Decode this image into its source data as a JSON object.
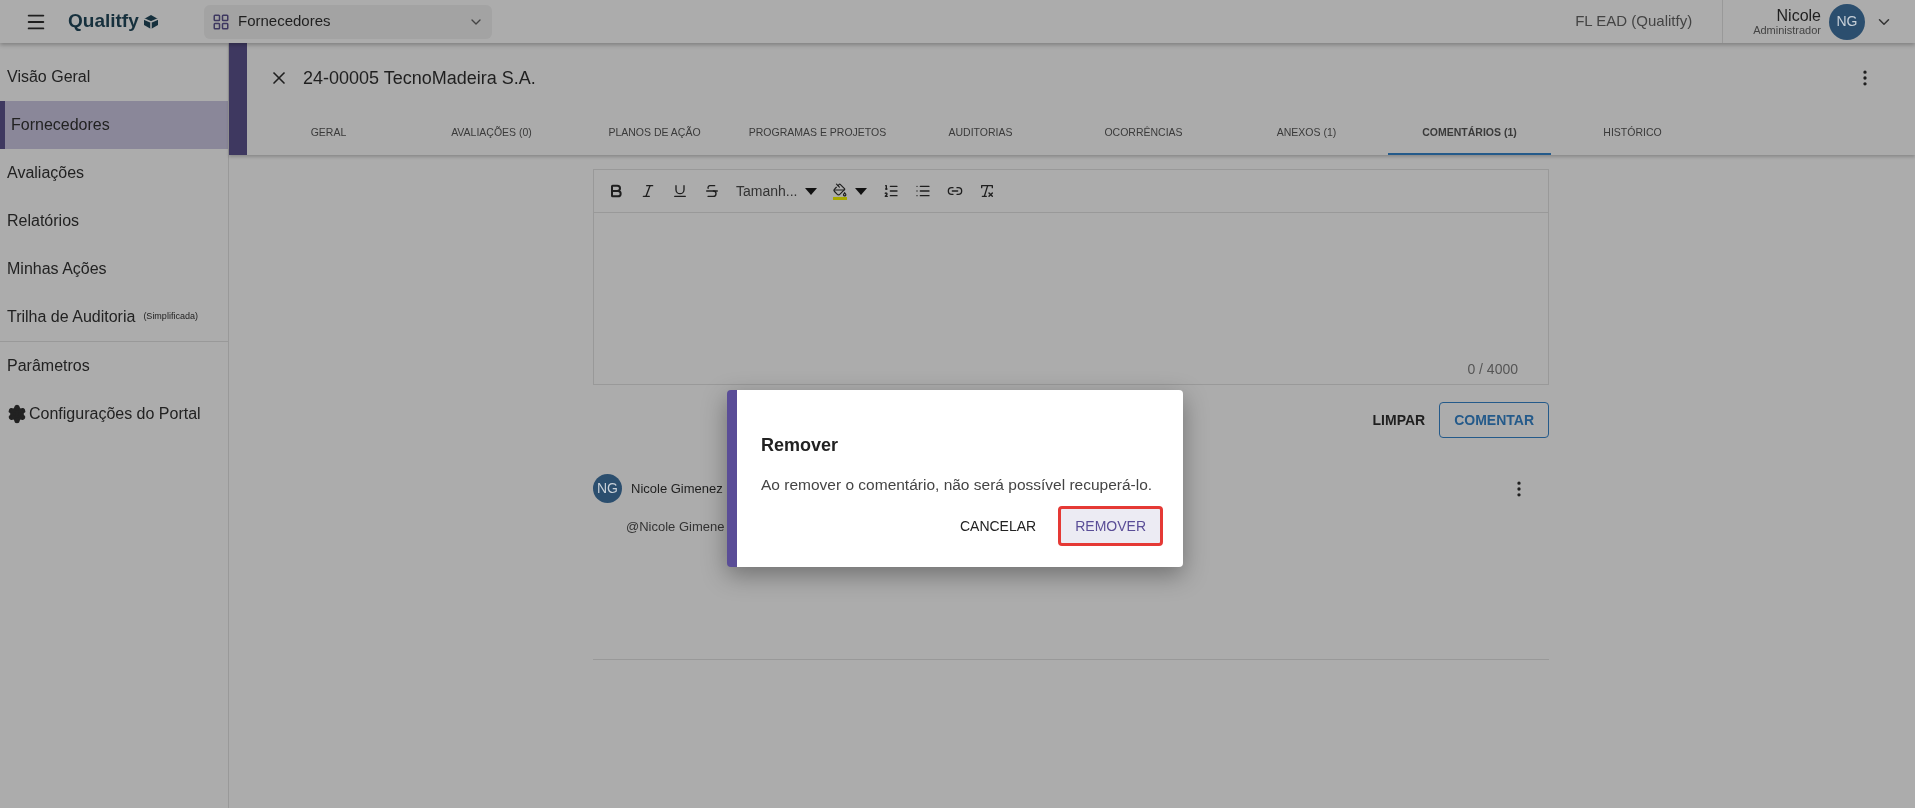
{
  "topbar": {
    "logo": "Qualitfy",
    "module": "Fornecedores",
    "tenant": "FL EAD (Qualitfy)",
    "user_name": "Nicole",
    "user_role": "Administrador",
    "avatar": "NG"
  },
  "sidebar": {
    "items": [
      {
        "label": "Visão Geral",
        "selected": false,
        "kind": "plain"
      },
      {
        "label": "Fornecedores",
        "selected": true,
        "kind": "plain"
      },
      {
        "label": "Avaliações",
        "selected": false,
        "kind": "plain"
      },
      {
        "label": "Relatórios",
        "selected": false,
        "kind": "plain"
      },
      {
        "label": "Minhas Ações",
        "selected": false,
        "kind": "plain"
      },
      {
        "label": "Trilha de Auditoria",
        "note": "(Simplificada)",
        "selected": false,
        "kind": "plain"
      },
      {
        "label": "Parâmetros",
        "selected": false,
        "kind": "divided"
      },
      {
        "label": "Configurações do Portal",
        "selected": false,
        "kind": "gear"
      }
    ]
  },
  "record": {
    "title": "24-00005 TecnoMadeira S.A.",
    "tabs": [
      {
        "label": "GERAL",
        "selected": false
      },
      {
        "label": "AVALIAÇÕES (0)",
        "selected": false
      },
      {
        "label": "PLANOS DE AÇÃO",
        "selected": false
      },
      {
        "label": "PROGRAMAS E PROJETOS",
        "selected": false
      },
      {
        "label": "AUDITORIAS",
        "selected": false
      },
      {
        "label": "OCORRÊNCIAS",
        "selected": false
      },
      {
        "label": "ANEXOS (1)",
        "selected": false
      },
      {
        "label": "COMENTÁRIOS (1)",
        "selected": true
      },
      {
        "label": "HISTÓRICO",
        "selected": false
      }
    ]
  },
  "editor": {
    "size_select": "Tamanh...",
    "counter": "0 / 4000",
    "clear_button": "LIMPAR",
    "submit_button": "COMENTAR"
  },
  "comment": {
    "avatar": "NG",
    "author": "Nicole Gimenez",
    "text": "@Nicole Gimene"
  },
  "dialog": {
    "title": "Remover",
    "message": "Ao remover o comentário, não será possível recuperá-lo.",
    "cancel_button": "CANCELAR",
    "confirm_button": "REMOVER",
    "confirm_highlighted": true
  }
}
